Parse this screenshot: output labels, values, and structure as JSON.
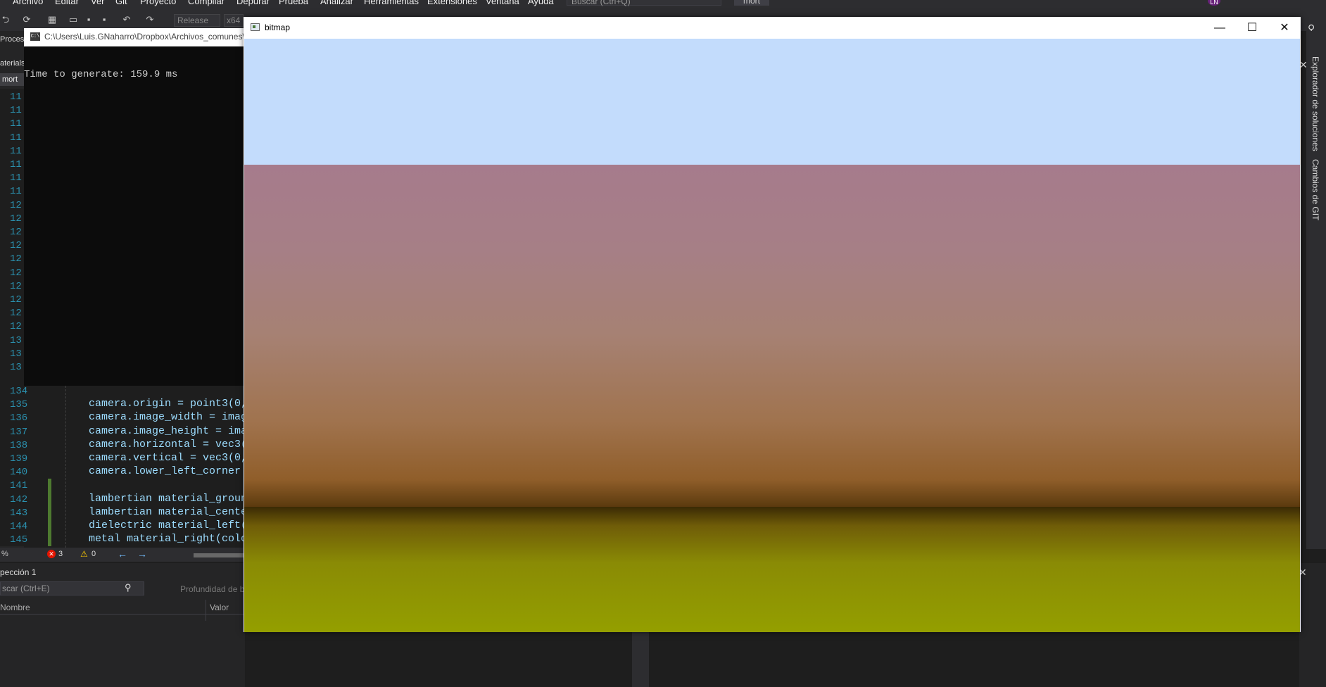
{
  "vs": {
    "menu": [
      "Archivo",
      "Editar",
      "Ver",
      "Git",
      "Proyecto",
      "Compilar",
      "Depurar",
      "Prueba",
      "Analizar",
      "Herramientas",
      "Extensiones",
      "Ventana",
      "Ayuda"
    ],
    "search_placeholder": "Buscar (Ctrl+Q)",
    "project_name": "mort",
    "user_initials": "LN",
    "toolbar": {
      "config": "Release",
      "platform": "x64"
    },
    "left_panel": {
      "procesos_label": "Proces",
      "materials_label": "aterials",
      "tab_label": "mort"
    },
    "gutter_lines_hidden": [
      "11",
      "11",
      "11",
      "11",
      "11",
      "11",
      "11",
      "11",
      "12",
      "12",
      "12",
      "12",
      "12",
      "12",
      "12",
      "12",
      "12",
      "12",
      "13",
      "13",
      "13"
    ],
    "code_lines": [
      {
        "num": "134",
        "text": ""
      },
      {
        "num": "135",
        "text": "camera.origin = point3(0,"
      },
      {
        "num": "136",
        "text": "camera.image_width = imag"
      },
      {
        "num": "137",
        "text": "camera.image_height = ima"
      },
      {
        "num": "138",
        "text": "camera.horizontal = vec3("
      },
      {
        "num": "139",
        "text": "camera.vertical = vec3(0,"
      },
      {
        "num": "140",
        "text": "camera.lower_left_corner "
      },
      {
        "num": "141",
        "text": ""
      },
      {
        "num": "142",
        "text": "lambertian material_groun"
      },
      {
        "num": "143",
        "text": "lambertian material_cente"
      },
      {
        "num": "144",
        "text": "dielectric material_left("
      },
      {
        "num": "145",
        "text": "metal material_right(colo"
      }
    ],
    "status": {
      "zoom": "%",
      "errors": "3",
      "warnings": "0"
    },
    "inspect": {
      "title": "pección 1",
      "search_placeholder": "scar (Ctrl+E)",
      "depth_label": "Profundidad de b",
      "col_name": "Nombre",
      "col_value": "Valor"
    },
    "right_sidebar": {
      "solution_explorer": "Explorador de soluciones",
      "git_changes": "Cambios de GIT"
    }
  },
  "console": {
    "title_path": "C:\\Users\\Luis.GNaharro\\Dropbox\\Archivos_comunes\\",
    "output": "Time to generate: 159.9 ms"
  },
  "bitmap": {
    "title": "bitmap",
    "buttons": {
      "minimize": "—",
      "maximize": "☐",
      "close": "✕"
    },
    "colors": {
      "sky": "#c3dcfc",
      "sphere_top": "#a67b8c",
      "sphere_bottom": "#905e2a",
      "ground": "#949f00"
    }
  }
}
